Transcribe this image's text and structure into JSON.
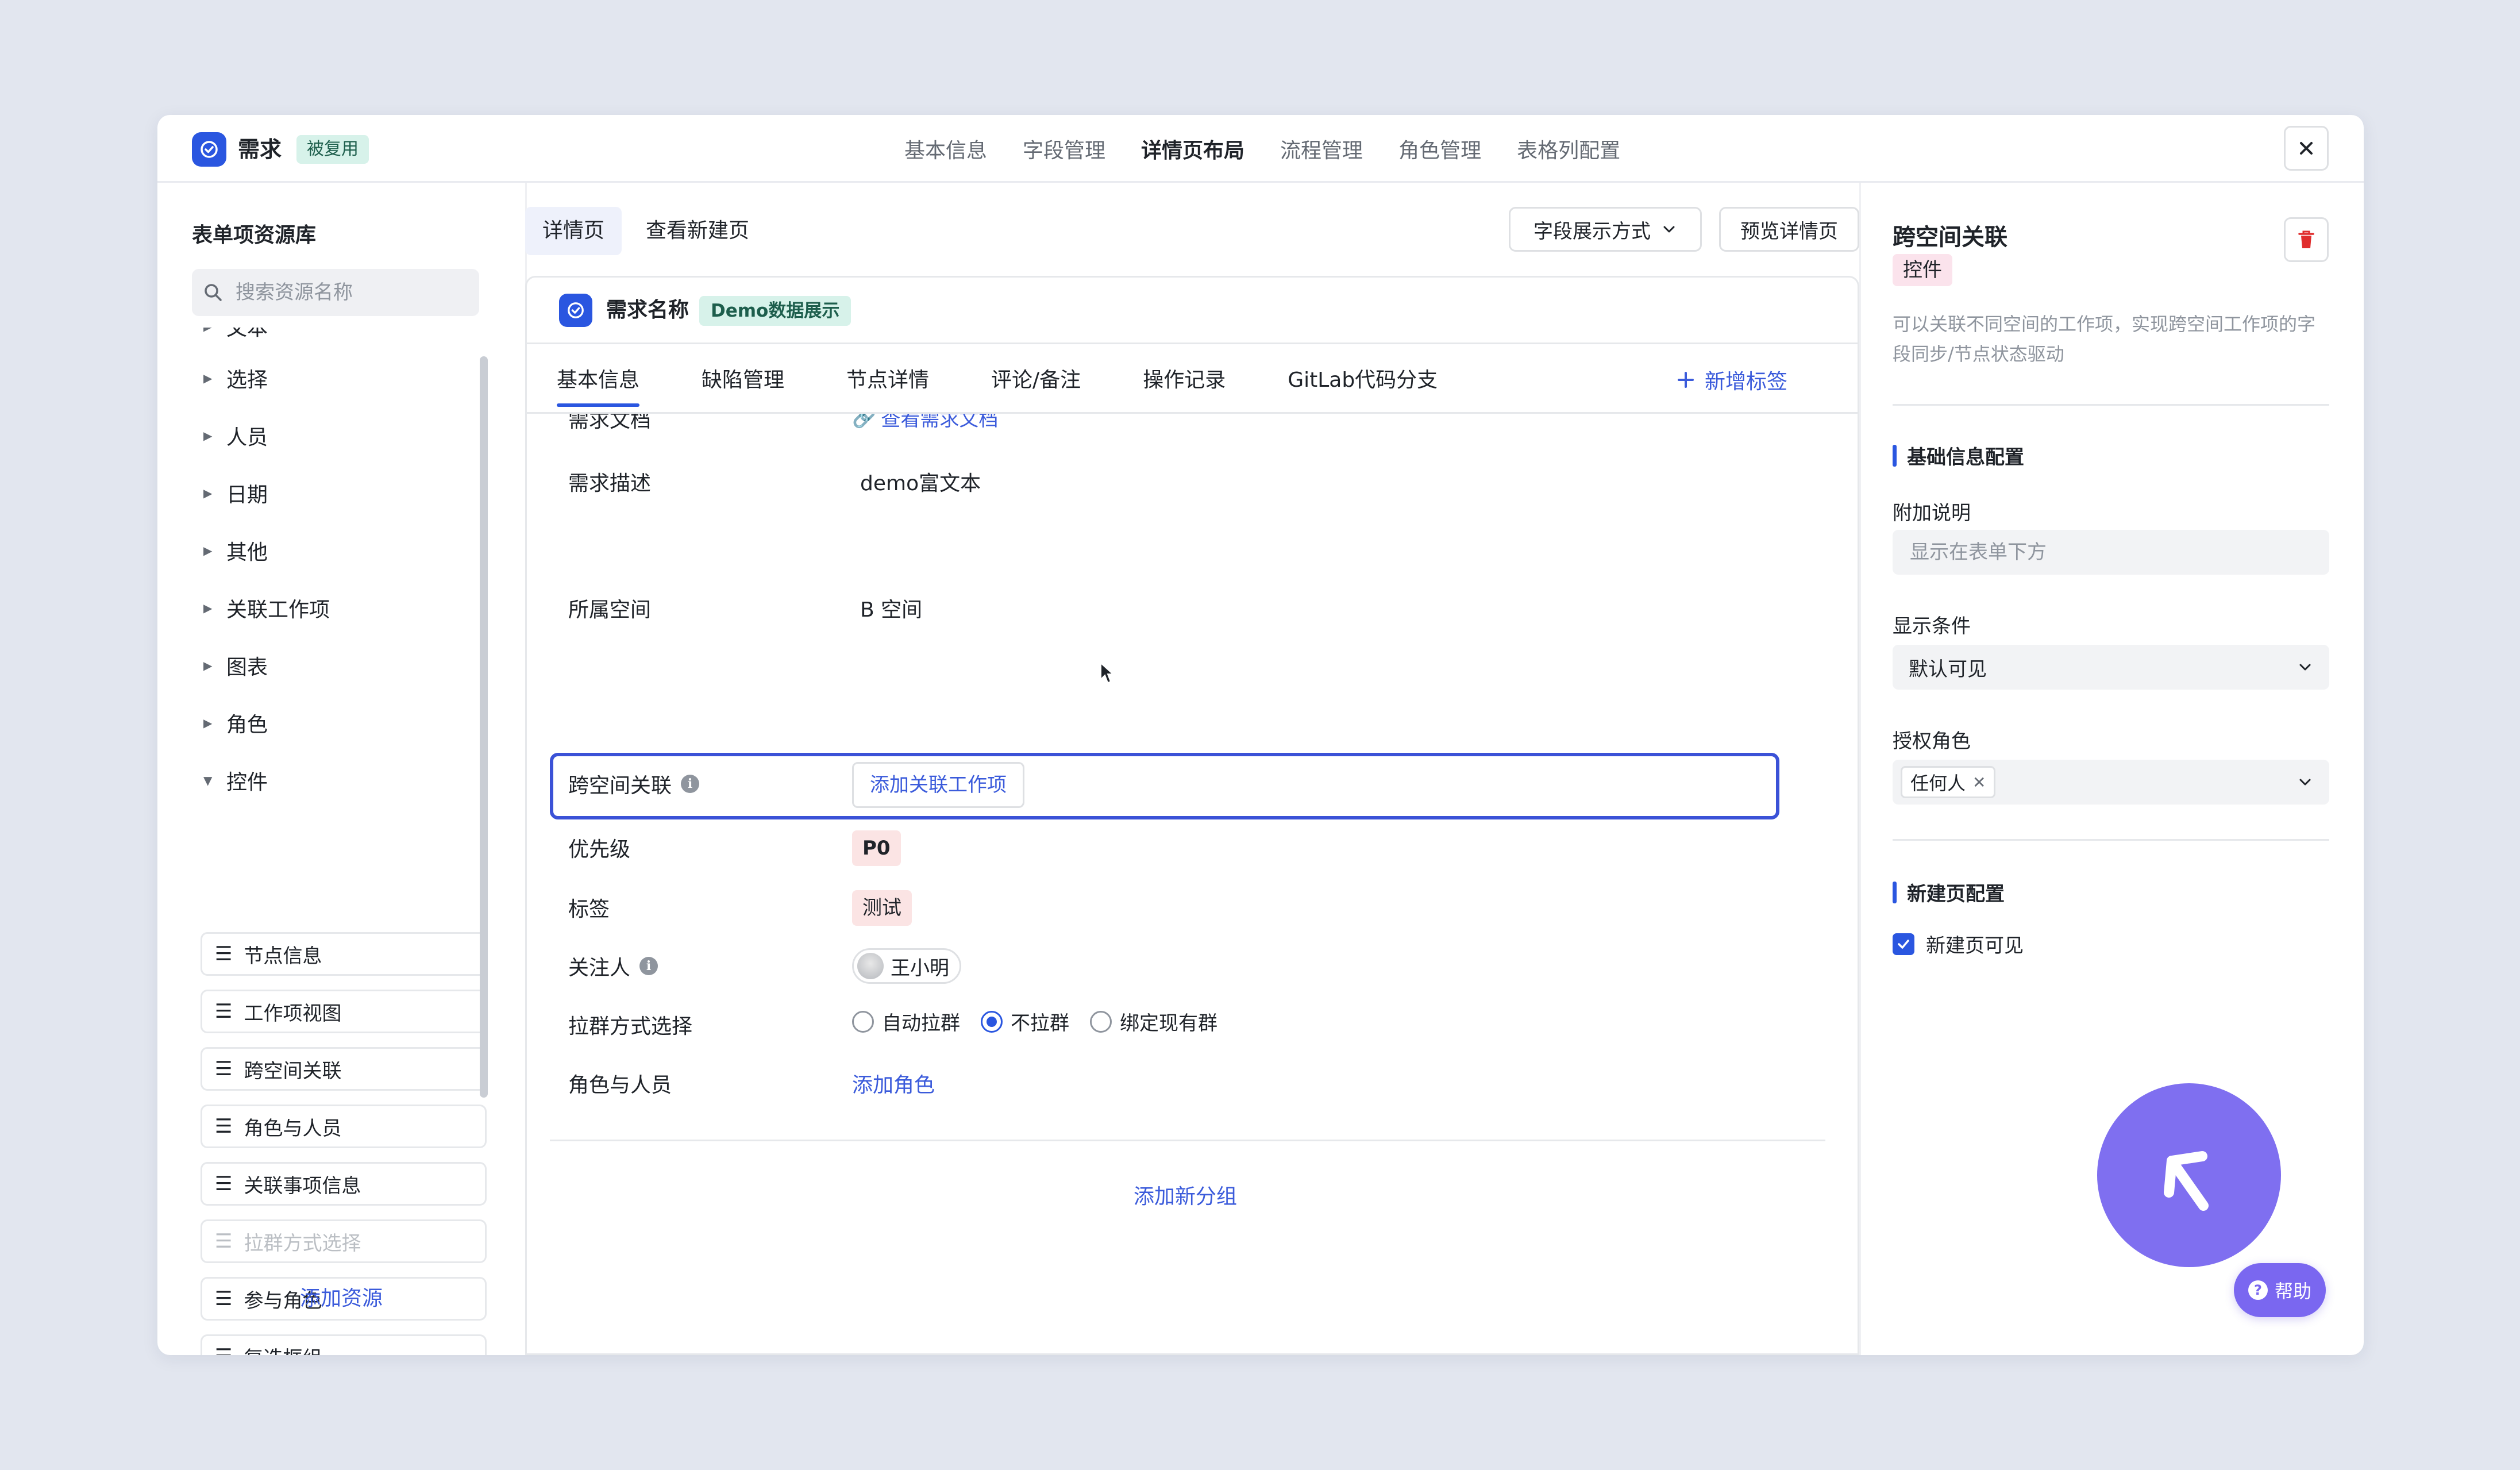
{
  "app": {
    "title": "需求",
    "badge": "被复用",
    "close_icon": "close-icon"
  },
  "top_tabs": [
    {
      "label": "基本信息",
      "active": false
    },
    {
      "label": "字段管理",
      "active": false
    },
    {
      "label": "详情页布局",
      "active": true
    },
    {
      "label": "流程管理",
      "active": false
    },
    {
      "label": "角色管理",
      "active": false
    },
    {
      "label": "表格列配置",
      "active": false
    }
  ],
  "left_panel": {
    "title": "表单项资源库",
    "search_placeholder": "搜索资源名称",
    "categories": [
      "文本",
      "选择",
      "人员",
      "日期",
      "其他",
      "关联工作项",
      "图表",
      "角色",
      "控件"
    ],
    "widget_items": [
      {
        "label": "节点信息",
        "disabled": false
      },
      {
        "label": "工作项视图",
        "disabled": false
      },
      {
        "label": "跨空间关联",
        "disabled": false
      },
      {
        "label": "角色与人员",
        "disabled": false
      },
      {
        "label": "关联事项信息",
        "disabled": false
      },
      {
        "label": "拉群方式选择",
        "disabled": true
      },
      {
        "label": "参与角色",
        "disabled": false
      },
      {
        "label": "复选框组",
        "disabled": false
      }
    ],
    "add_resource": "添加资源"
  },
  "center": {
    "seg_tabs": [
      {
        "label": "详情页",
        "active": true
      },
      {
        "label": "查看新建页",
        "active": false
      }
    ],
    "field_display_btn": "字段展示方式",
    "preview_btn": "预览详情页",
    "card": {
      "name": "需求名称",
      "badge": "Demo数据展示",
      "tabs": [
        "基本信息",
        "缺陷管理",
        "节点详情",
        "评论/备注",
        "操作记录",
        "GitLab代码分支"
      ],
      "add_tag": "新增标签",
      "fields": {
        "doc_label": "需求文档",
        "doc_link": "查看需求文档",
        "desc_label": "需求描述",
        "desc_value": "demo富文本",
        "space_label": "所属空间",
        "space_value": "B 空间",
        "cross_label": "跨空间关联",
        "cross_btn": "添加关联工作项",
        "priority_label": "优先级",
        "priority_value": "P0",
        "tag_label": "标签",
        "tag_value": "测试",
        "watcher_label": "关注人",
        "watcher_value": "王小明",
        "group_label": "拉群方式选择",
        "group_options": [
          {
            "label": "自动拉群",
            "checked": false
          },
          {
            "label": "不拉群",
            "checked": true
          },
          {
            "label": "绑定现有群",
            "checked": false
          }
        ],
        "role_label": "角色与人员",
        "role_link": "添加角色"
      },
      "add_group": "添加新分组"
    }
  },
  "right_panel": {
    "title": "跨空间关联",
    "badge": "控件",
    "description": "可以关联不同空间的工作项，实现跨空间工作项的字段同步/节点状态驱动",
    "basic_section": "基础信息配置",
    "note_label": "附加说明",
    "note_placeholder": "显示在表单下方",
    "condition_label": "显示条件",
    "condition_value": "默认可见",
    "role_label": "授权角色",
    "role_chip": "任何人",
    "new_page_section": "新建页配置",
    "new_page_visible": "新建页可见",
    "help": "帮助"
  },
  "colors": {
    "accent": "#2a56e0",
    "link": "#3b5bdb",
    "help": "#7a67f0"
  }
}
